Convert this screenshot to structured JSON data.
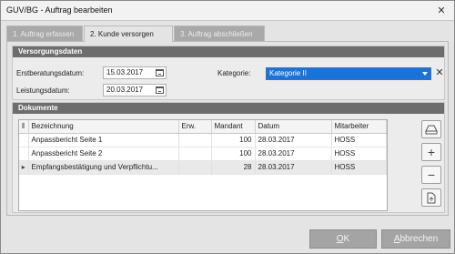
{
  "window": {
    "title": "GUV/BG - Auftrag bearbeiten",
    "close_label": "✕"
  },
  "tabs": [
    {
      "label": "1. Auftrag erfassen",
      "active": false
    },
    {
      "label": "2. Kunde versorgen",
      "active": true
    },
    {
      "label": "3. Auftrag abschließen",
      "active": false
    }
  ],
  "versorgung": {
    "header": "Versorgungsdaten",
    "erstberatung_label": "Erstberatungsdatum:",
    "erstberatung_value": "15.03.2017",
    "leistung_label": "Leistungsdatum:",
    "leistung_value": "20.03.2017",
    "kategorie_label": "Kategorie:",
    "kategorie_value": "Kategorie II",
    "clear_label": "✕"
  },
  "dokumente": {
    "header": "Dokumente",
    "columns": [
      "Bezeichnung",
      "Erw.",
      "Mandant",
      "Datum",
      "Mitarbeiter"
    ],
    "rows": [
      {
        "bezeichnung": "Anpassbericht Seite 1",
        "erw": "",
        "mandant": "100",
        "datum": "28.03.2017",
        "mitarbeiter": "HOSS",
        "current": false
      },
      {
        "bezeichnung": "Anpassbericht Seite 2",
        "erw": "",
        "mandant": "100",
        "datum": "28.03.2017",
        "mitarbeiter": "HOSS",
        "current": false
      },
      {
        "bezeichnung": "Empfangsbestätigung und Verpflichtu...",
        "erw": "",
        "mandant": "28",
        "datum": "28.03.2017",
        "mitarbeiter": "HOSS",
        "current": true
      }
    ],
    "buttons": {
      "scan": "scan-icon",
      "add": "+",
      "remove": "−",
      "document": "document-icon"
    }
  },
  "footer": {
    "ok": {
      "underlined": "O",
      "rest": "K"
    },
    "cancel": {
      "underlined": "A",
      "rest": "bbrechen"
    }
  },
  "colors": {
    "accent": "#1a73d9",
    "group_header": "#6d6d6d",
    "tab_inactive": "#a9a9a9"
  }
}
